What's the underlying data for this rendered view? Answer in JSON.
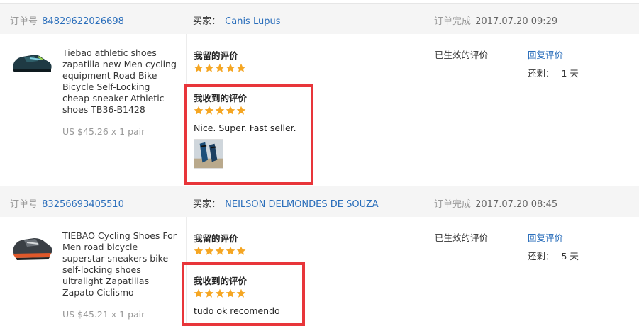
{
  "labels": {
    "order_id": "订单号",
    "buyer": "买家：",
    "order_done": "订单完成",
    "my_feedback": "我留的评价",
    "received_feedback": "我收到的评价",
    "effective": "已生效的评价",
    "reply": "回复评价",
    "remaining": "还剩："
  },
  "orders": [
    {
      "id": "84829622026698",
      "buyer": "Canis Lupus",
      "completed_time": "2017.07.20 09:29",
      "product_title": "Tiebao athletic shoes zapatilla new Men cycling equipment Road Bike Bicycle Self-Locking cheap-sneaker Athletic shoes TB36-B1428",
      "price": "US $45.26 x 1 pair",
      "my_rating": 5,
      "received_rating": 5,
      "received_comment": "Nice. Super. Fast seller.",
      "remaining": "1 天"
    },
    {
      "id": "83256693405510",
      "buyer": "NEILSON DELMONDES DE SOUZA",
      "completed_time": "2017.07.20 08:45",
      "product_title": "TIEBAO Cycling Shoes For Men road bicycle superstar sneakers bike self-locking shoes ultralight Zapatillas Zapato Ciclismo",
      "price": "US $45.21 x 1 pair",
      "my_rating": 5,
      "received_rating": 5,
      "received_comment": "tudo ok recomendo",
      "remaining": "5 天"
    }
  ],
  "colors": {
    "link": "#2a6ebb",
    "star": "#f5a623",
    "highlight_box": "#e8353a",
    "header_bg": "#f5f5f5"
  }
}
